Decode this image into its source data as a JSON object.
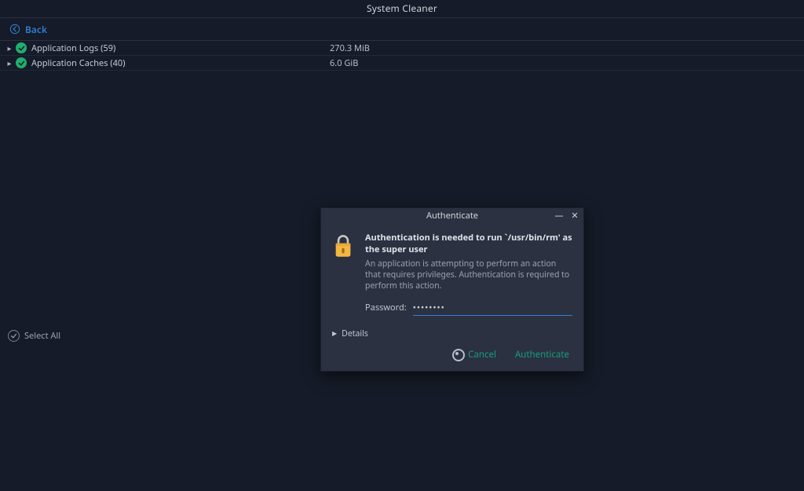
{
  "window": {
    "title": "System Cleaner"
  },
  "back": {
    "label": "Back"
  },
  "list": {
    "items": [
      {
        "name": "Application Logs (59)",
        "size": "270.3 MiB"
      },
      {
        "name": "Application Caches (40)",
        "size": "6.0 GiB"
      }
    ]
  },
  "select_all": {
    "label": "Select All"
  },
  "dialog": {
    "title": "Authenticate",
    "headline": "Authentication is needed to run `/usr/bin/rm' as the super user",
    "subline": "An application is attempting to perform an action that requires privileges. Authentication is required to perform this action.",
    "password_label": "Password:",
    "password_value": "••••••••",
    "details_label": "Details",
    "cancel_label": "Cancel",
    "authenticate_label": "Authenticate"
  }
}
